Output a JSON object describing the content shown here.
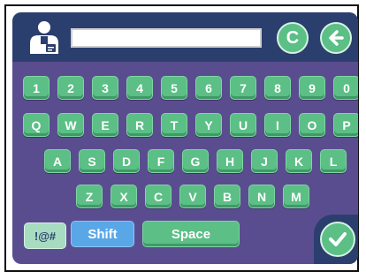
{
  "input": {
    "value": "",
    "placeholder": ""
  },
  "toolbar": {
    "clear_label": "C",
    "back_icon": "arrow-left-icon",
    "user_icon": "user-badge-icon"
  },
  "keyboard": {
    "row1": [
      "1",
      "2",
      "3",
      "4",
      "5",
      "6",
      "7",
      "8",
      "9",
      "0"
    ],
    "row2": [
      "Q",
      "W",
      "E",
      "R",
      "T",
      "Y",
      "U",
      "I",
      "O",
      "P"
    ],
    "row3": [
      "A",
      "S",
      "D",
      "F",
      "G",
      "H",
      "J",
      "K",
      "L"
    ],
    "row4": [
      "Z",
      "X",
      "C",
      "V",
      "B",
      "N",
      "M"
    ],
    "symbols_label": "!@#",
    "shift_label": "Shift",
    "space_label": "Space",
    "enter_icon": "checkmark-icon"
  },
  "colors": {
    "panel": "#5a4d8f",
    "topbar": "#2b3f6e",
    "key": "#5bbf86",
    "shift": "#5aa7e8",
    "symbols": "#a7dcc1"
  }
}
